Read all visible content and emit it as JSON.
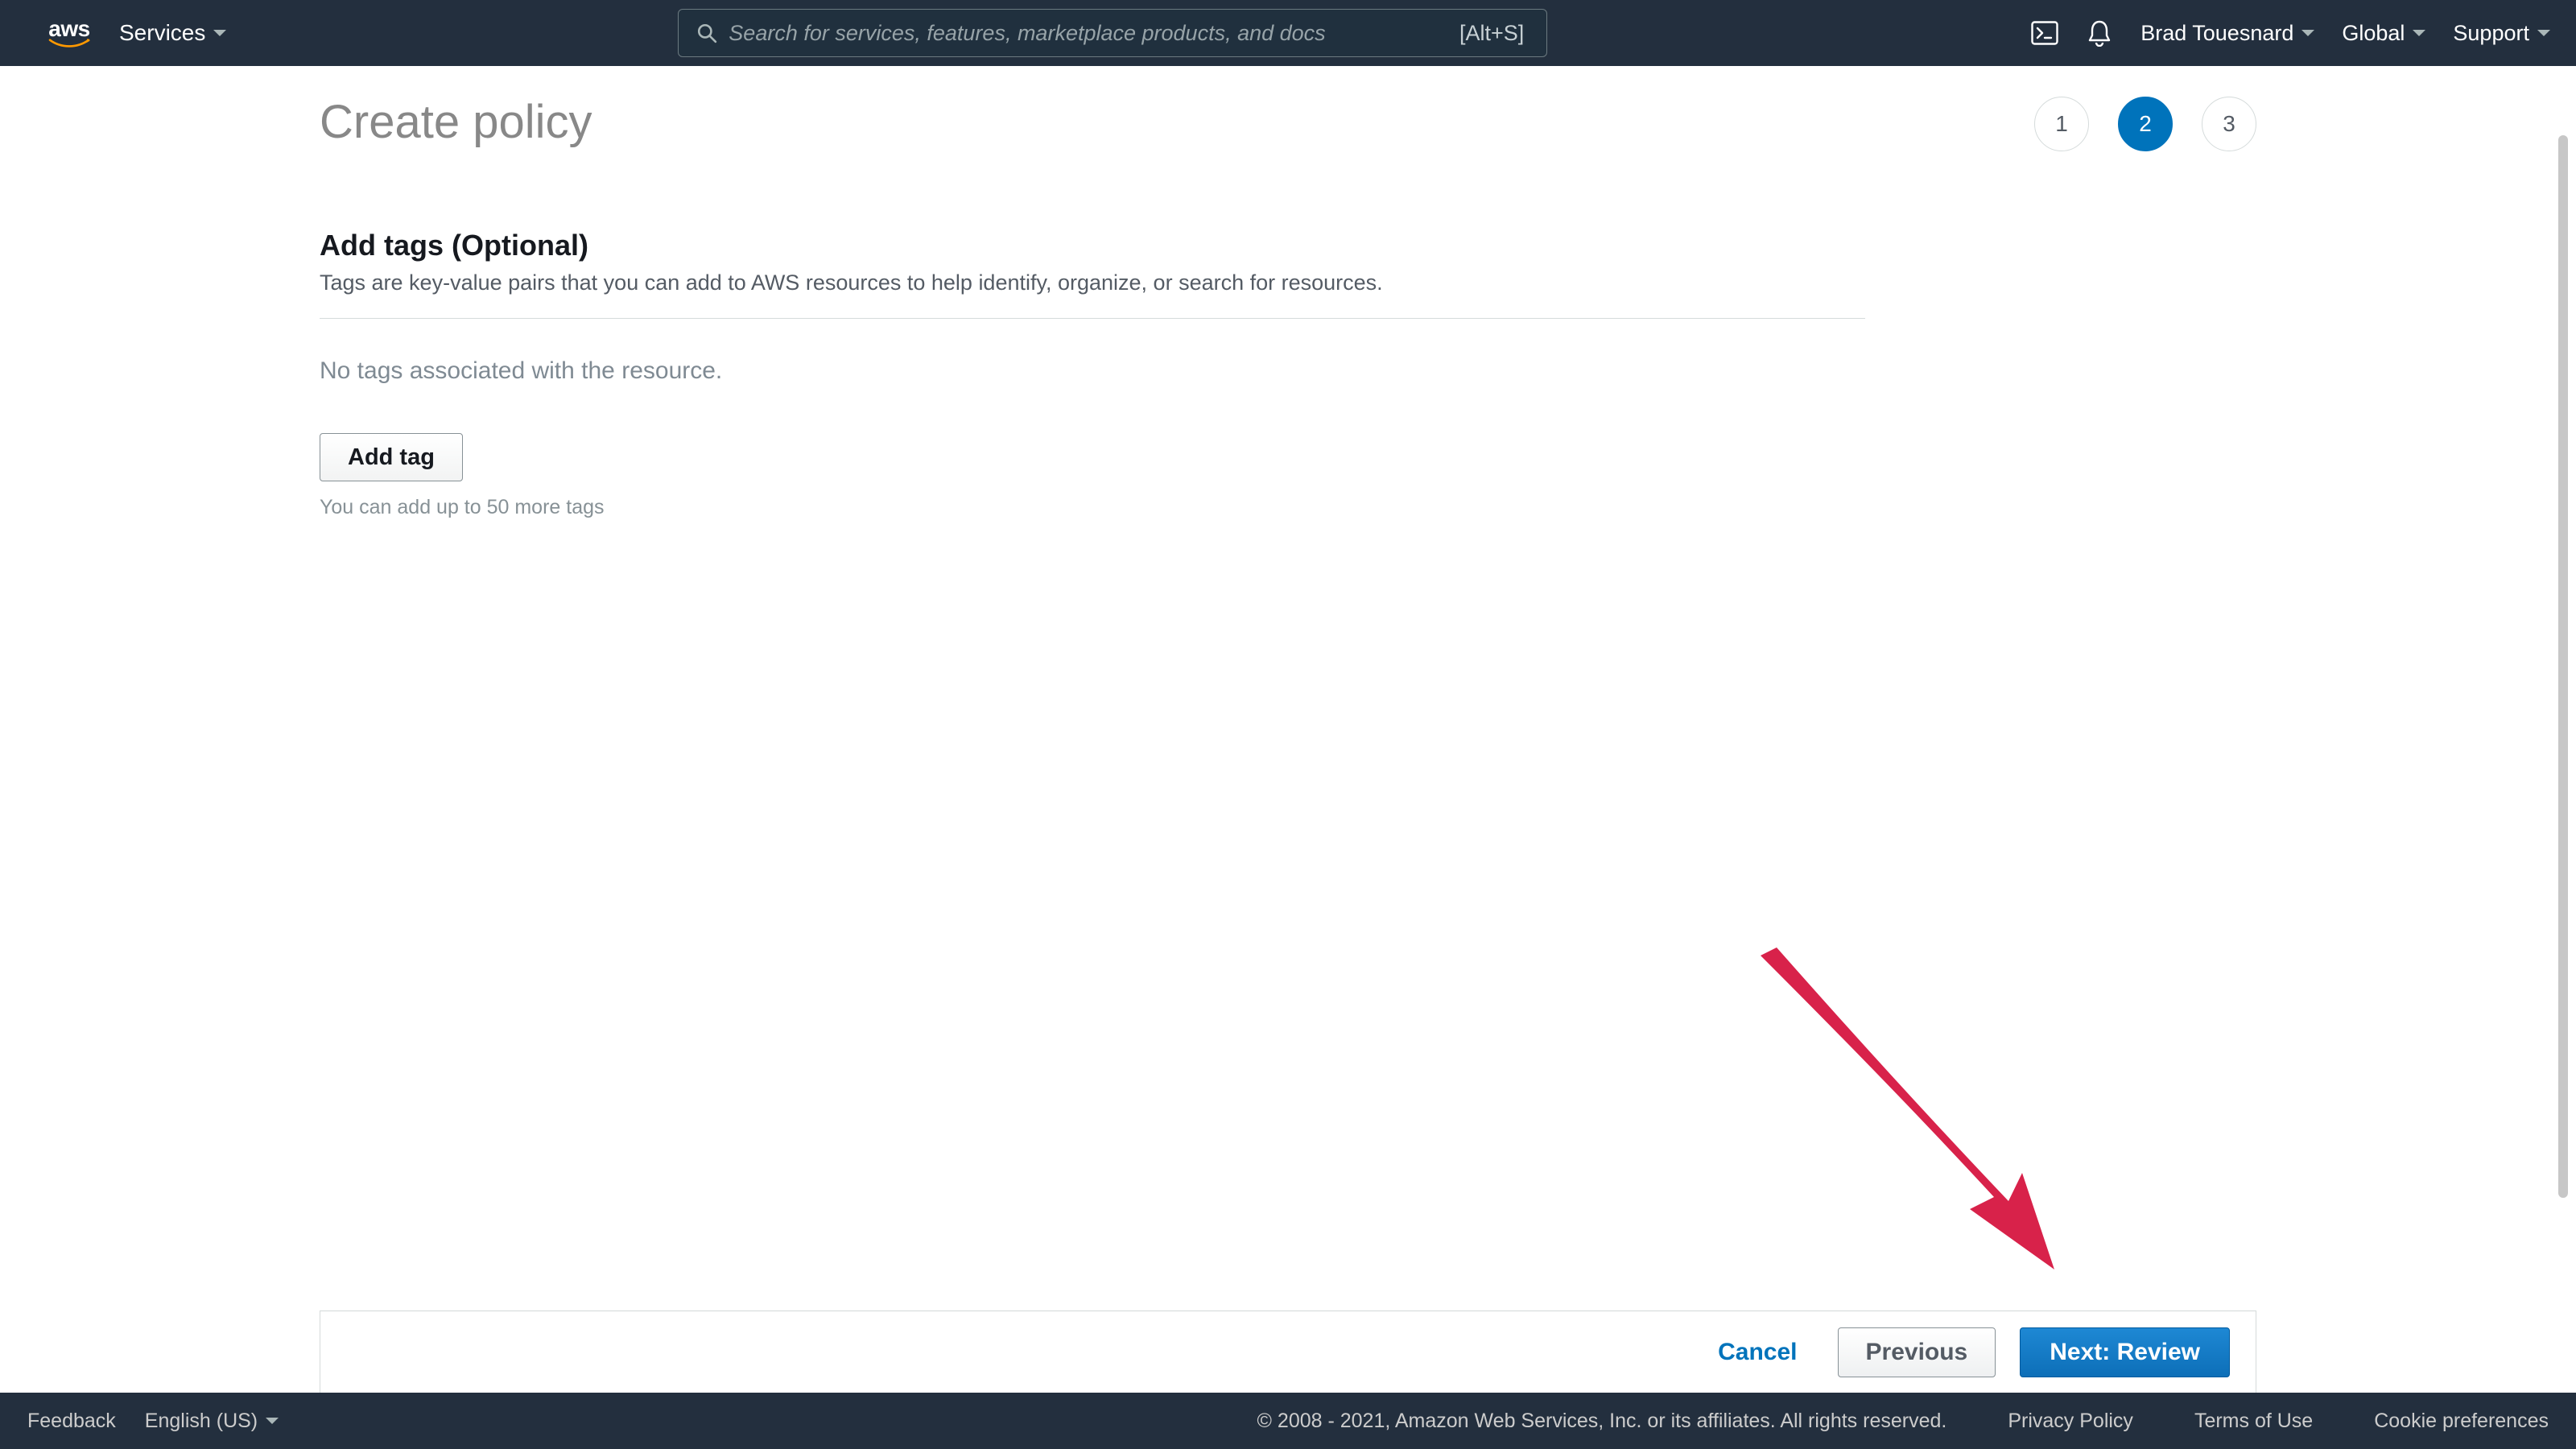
{
  "nav": {
    "logo_text": "aws",
    "services_label": "Services",
    "search_placeholder": "Search for services, features, marketplace products, and docs",
    "search_shortcut": "[Alt+S]",
    "user_name": "Brad Touesnard",
    "region_label": "Global",
    "support_label": "Support"
  },
  "page": {
    "title": "Create policy",
    "steps": [
      "1",
      "2",
      "3"
    ],
    "active_step_index": 1
  },
  "section": {
    "title": "Add tags (Optional)",
    "description": "Tags are key-value pairs that you can add to AWS resources to help identify, organize, or search for resources.",
    "empty_state": "No tags associated with the resource.",
    "add_button_label": "Add tag",
    "limit_hint": "You can add up to 50 more tags"
  },
  "wizard_footer": {
    "cancel_label": "Cancel",
    "previous_label": "Previous",
    "next_label": "Next: Review"
  },
  "statusbar": {
    "feedback_label": "Feedback",
    "language_label": "English (US)",
    "copyright": "© 2008 - 2021, Amazon Web Services, Inc. or its affiliates. All rights reserved.",
    "privacy_label": "Privacy Policy",
    "terms_label": "Terms of Use",
    "cookie_label": "Cookie preferences"
  },
  "annotation": {
    "arrow_color": "#d8224a"
  }
}
